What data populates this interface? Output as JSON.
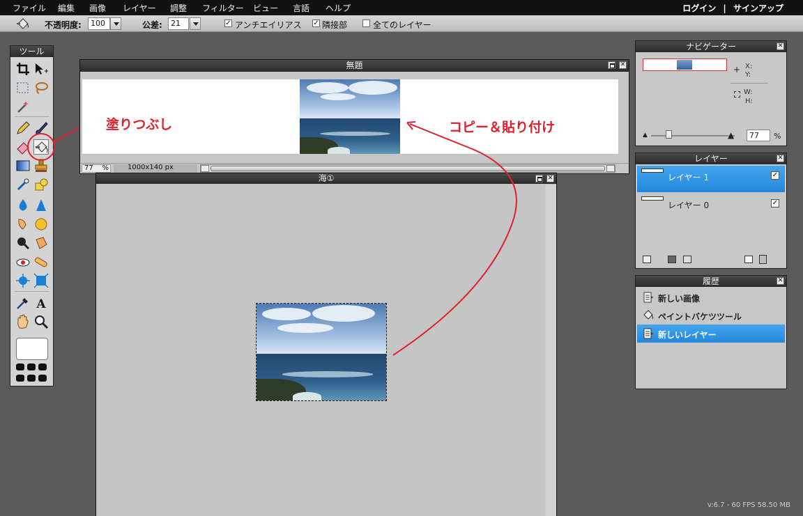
{
  "menubar": {
    "items": [
      "ファイル",
      "編集",
      "画像",
      "レイヤー",
      "調整",
      "フィルター",
      "ビュー",
      "言語",
      "ヘルプ"
    ],
    "login": "ログイン",
    "sep": "|",
    "signup": "サインアップ"
  },
  "options": {
    "opacity_label": "不透明度:",
    "opacity_value": "100",
    "tolerance_label": "公差:",
    "tolerance_value": "21",
    "antialias_label": "アンチエイリアス",
    "contiguous_label": "隣接部",
    "all_layers_label": "全てのレイヤー",
    "check_mark": "✓"
  },
  "tools": {
    "title": "ツール"
  },
  "top_window": {
    "title": "無題",
    "zoom": "77",
    "zoom_unit": "%",
    "size": "1000x140 px"
  },
  "sea_window": {
    "title": "海①"
  },
  "annotations": {
    "fill": "塗りつぶし",
    "copy": "コピー＆貼り付け",
    "color": "#e0202a"
  },
  "navigator": {
    "title": "ナビゲーター",
    "x_label": "X:",
    "y_label": "Y:",
    "w_label": "W:",
    "h_label": "H:",
    "zoom_value": "77",
    "zoom_unit": "%"
  },
  "layers": {
    "title": "レイヤー",
    "items": [
      {
        "name": "レイヤー 1",
        "visible": "✓"
      },
      {
        "name": "レイヤー 0",
        "visible": "✓"
      }
    ]
  },
  "history": {
    "title": "履歴",
    "items": [
      {
        "label": "新しい画像",
        "icon": "document-icon"
      },
      {
        "label": "ペイントバケツツール",
        "icon": "paint-bucket-icon"
      },
      {
        "label": "新しいレイヤー",
        "icon": "document-icon"
      }
    ]
  },
  "close_glyph": "✕",
  "footer": "v:6.7 - 60 FPS 58.50 MB"
}
